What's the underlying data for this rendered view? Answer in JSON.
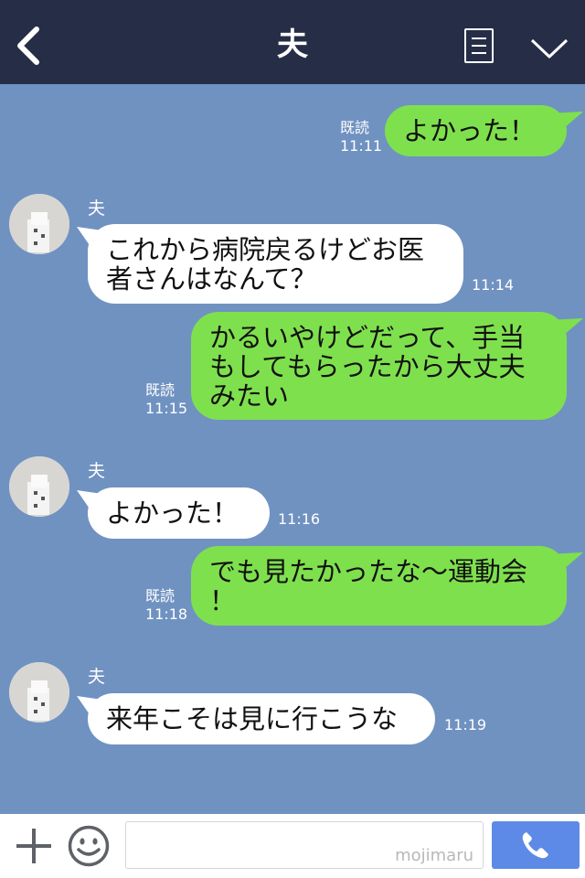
{
  "header": {
    "title": "夫"
  },
  "messages": [
    {
      "side": "out",
      "lines": [
        "よかった！"
      ],
      "read": "既読",
      "time": "11:11"
    },
    {
      "side": "in",
      "sender": "夫",
      "lines": [
        "これから病院戻るけどお医",
        "者さんはなんて？"
      ],
      "time": "11:14"
    },
    {
      "side": "out",
      "lines": [
        "かるいやけどだって、手当",
        "もしてもらったから大丈夫",
        "みたい"
      ],
      "read": "既読",
      "time": "11:15"
    },
    {
      "side": "in",
      "sender": "夫",
      "lines": [
        "よかった！"
      ],
      "time": "11:16"
    },
    {
      "side": "out",
      "lines": [
        "でも見たかったな〜運動会",
        "！"
      ],
      "read": "既読",
      "time": "11:18"
    },
    {
      "side": "in",
      "sender": "夫",
      "lines": [
        "来年こそは見に行こうな"
      ],
      "time": "11:19"
    }
  ],
  "footer": {
    "watermark": "mojimaru"
  },
  "colors": {
    "header_bg": "#262e47",
    "chat_bg": "#7092c1",
    "outgoing_bubble": "#7fe04e",
    "incoming_bubble": "#ffffff",
    "call_button": "#5c8ae6"
  },
  "icons": [
    "back-arrow-icon",
    "menu-list-icon",
    "chevron-down-icon",
    "plus-icon",
    "smiley-icon",
    "phone-icon"
  ]
}
